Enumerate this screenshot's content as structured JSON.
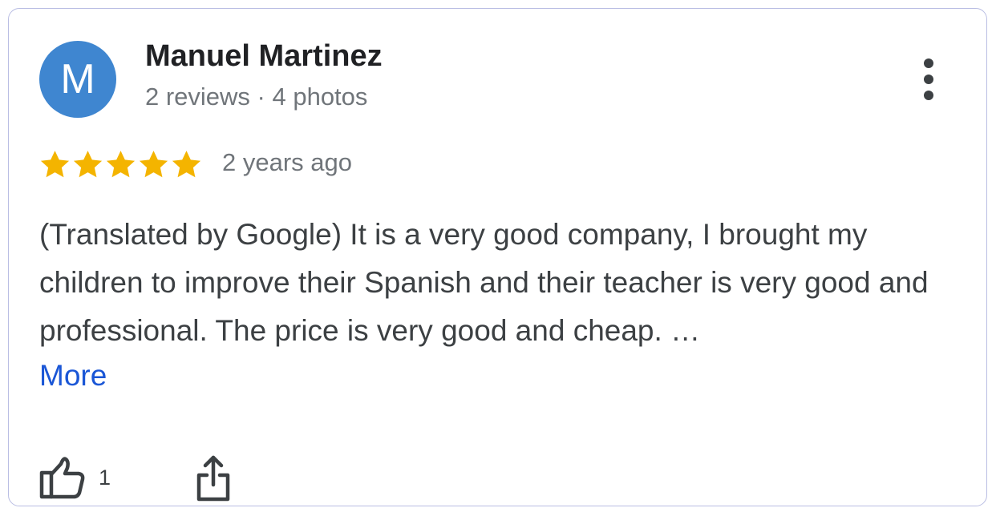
{
  "review": {
    "author": {
      "initial": "M",
      "name": "Manuel Martinez",
      "meta": "2 reviews · 4 photos",
      "avatar_color": "#3f86d0"
    },
    "rating": 5,
    "max_rating": 5,
    "star_color": "#f4b400",
    "time_ago": "2 years ago",
    "text": "(Translated by Google) It is a very good company, I brought my children to improve their Spanish and their teacher is very good and professional. The price is very good and cheap. …",
    "more_label": "More",
    "like_count": "1",
    "icons": {
      "menu": "more-vert-icon",
      "like": "thumb-up-icon",
      "share": "share-icon",
      "star": "star-icon"
    }
  }
}
